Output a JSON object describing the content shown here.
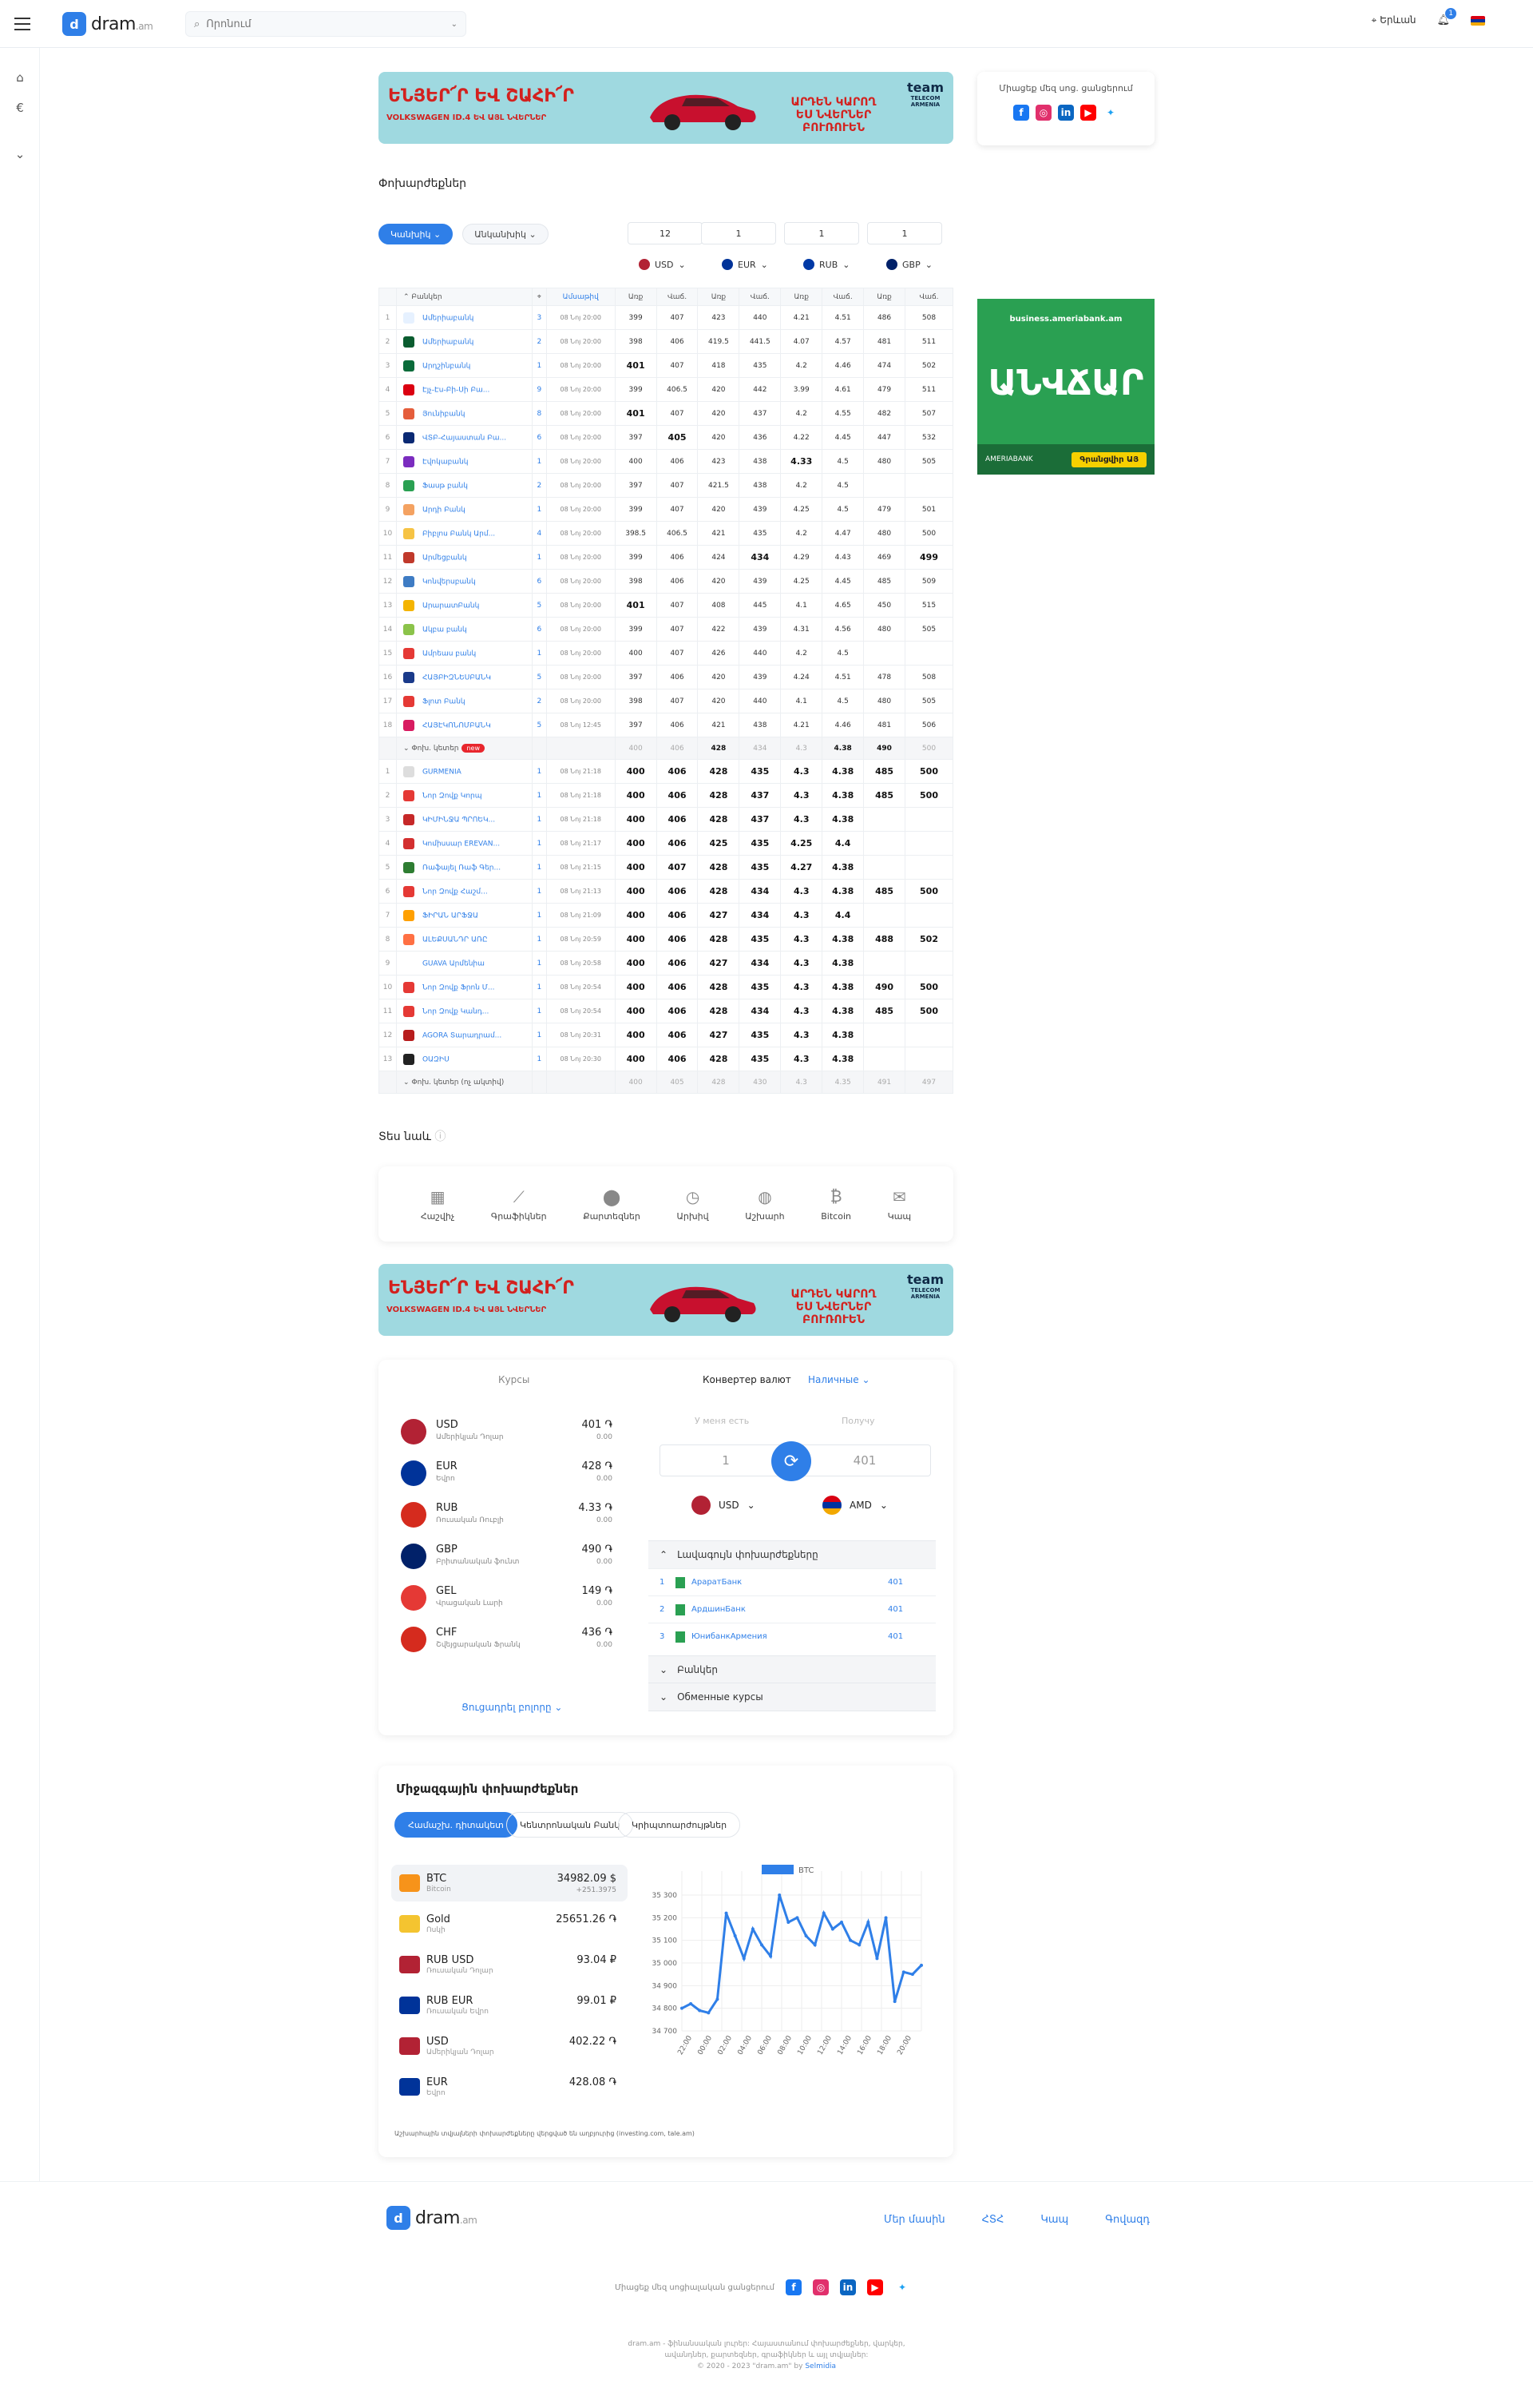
{
  "header": {
    "logo_text": "dram",
    "logo_domain": ".am",
    "search_placeholder": "Որոնում",
    "city": "Երևան",
    "notif_count": "1"
  },
  "banner": {
    "line1": "ԵՆՅԵՐ՜Ր ԵՎ ՇԱՀԻ՜Ր",
    "line2": "VOLKSWAGEN ID.4 ԵՎ ԱՅԼ ՆՎԵՐՆԵՐ",
    "right": "ԱՐԴԵՆ ԿԱՐՈՂ ԵՍ ՆՎԵՐՆԵՐ ԲՈՒՌՈՒԵՆ",
    "brand": "team",
    "brand_sub": "TELECOM ARMENIA"
  },
  "social": {
    "title": "Միացեք մեզ սոց. ցանցերում"
  },
  "section_title": "Փոխարժեքներ",
  "tabs": [
    "Կանխիկ",
    "Անկանխիկ"
  ],
  "amounts": [
    "12",
    "1",
    "1",
    "1"
  ],
  "currencies": [
    {
      "code": "USD",
      "color": "#b22234"
    },
    {
      "code": "EUR",
      "color": "#003399"
    },
    {
      "code": "RUB",
      "color": "#0039a6"
    },
    {
      "code": "GBP",
      "color": "#012169"
    }
  ],
  "ad_right": {
    "url": "business.ameriabank.am",
    "big": "ԱՆՎՃԱՐ",
    "bank": "AMERIABANK",
    "button": "Գրանցվիր ԱՅ"
  },
  "table": {
    "headers": {
      "banks": "Բանկեր",
      "date": "Ամսաթիվ",
      "buy": "Առք",
      "sell": "Վաճ."
    },
    "banks": [
      {
        "n": "1",
        "name": "Ամերիաբանկ",
        "br": "3",
        "t": "08 Նոյ 20:00",
        "v": [
          "399",
          "407",
          "423",
          "440",
          "4.21",
          "4.51",
          "486",
          "508"
        ],
        "c": "#e6f1ff"
      },
      {
        "n": "2",
        "name": "Ամերիաբանկ",
        "br": "2",
        "t": "08 Նոյ 20:00",
        "v": [
          "398",
          "406",
          "419.5",
          "441.5",
          "4.07",
          "4.57",
          "481",
          "511"
        ],
        "c": "#0a5c2f"
      },
      {
        "n": "3",
        "name": "Արդշինբանկ",
        "br": "1",
        "t": "08 Նոյ 20:00",
        "v": [
          "401",
          "407",
          "418",
          "435",
          "4.2",
          "4.46",
          "474",
          "502"
        ],
        "c": "#0a6b3a"
      },
      {
        "n": "4",
        "name": "Էյչ-Էս-Բի-Սի Բա...",
        "br": "9",
        "t": "08 Նոյ 20:00",
        "v": [
          "399",
          "406.5",
          "420",
          "442",
          "3.99",
          "4.61",
          "479",
          "511"
        ],
        "c": "#db0011"
      },
      {
        "n": "5",
        "name": "Յունիբանկ",
        "br": "8",
        "t": "08 Նոյ 20:00",
        "v": [
          "401",
          "407",
          "420",
          "437",
          "4.2",
          "4.55",
          "482",
          "507"
        ],
        "c": "#e55d3b"
      },
      {
        "n": "6",
        "name": "ՎՏԲ-Հայաստան Բա...",
        "br": "6",
        "t": "08 Նոյ 20:00",
        "v": [
          "397",
          "405",
          "420",
          "436",
          "4.22",
          "4.45",
          "447",
          "532"
        ],
        "c": "#0a2973"
      },
      {
        "n": "7",
        "name": "Էվոկաբանկ",
        "br": "1",
        "t": "08 Նոյ 20:00",
        "v": [
          "400",
          "406",
          "423",
          "438",
          "4.33",
          "4.5",
          "480",
          "505"
        ],
        "c": "#7b2cbf"
      },
      {
        "n": "8",
        "name": "Ֆասթ բանկ",
        "br": "2",
        "t": "08 Նոյ 20:00",
        "v": [
          "397",
          "407",
          "421.5",
          "438",
          "4.2",
          "4.5",
          "",
          ""
        ],
        "c": "#2aa052"
      },
      {
        "n": "9",
        "name": "Արդի Բանկ",
        "br": "1",
        "t": "08 Նոյ 20:00",
        "v": [
          "399",
          "407",
          "420",
          "439",
          "4.25",
          "4.5",
          "479",
          "501"
        ],
        "c": "#f4a261"
      },
      {
        "n": "10",
        "name": "Բիբլոս Բանկ Արմ...",
        "br": "4",
        "t": "08 Նոյ 20:00",
        "v": [
          "398.5",
          "406.5",
          "421",
          "435",
          "4.2",
          "4.47",
          "480",
          "500"
        ],
        "c": "#f6c344"
      },
      {
        "n": "11",
        "name": "Արմեցբանկ",
        "br": "1",
        "t": "08 Նոյ 20:00",
        "v": [
          "399",
          "406",
          "424",
          "434",
          "4.29",
          "4.43",
          "469",
          "499"
        ],
        "c": "#c0392b"
      },
      {
        "n": "12",
        "name": "Կոնվերսբանկ",
        "br": "6",
        "t": "08 Նոյ 20:00",
        "v": [
          "398",
          "406",
          "420",
          "439",
          "4.25",
          "4.45",
          "485",
          "509"
        ],
        "c": "#3e7cc4"
      },
      {
        "n": "13",
        "name": "ԱրարատԲանկ",
        "br": "5",
        "t": "08 Նոյ 20:00",
        "v": [
          "401",
          "407",
          "408",
          "445",
          "4.1",
          "4.65",
          "450",
          "515"
        ],
        "c": "#f4b400"
      },
      {
        "n": "14",
        "name": "Ակբա բանկ",
        "br": "6",
        "t": "08 Նոյ 20:00",
        "v": [
          "399",
          "407",
          "422",
          "439",
          "4.31",
          "4.56",
          "480",
          "505"
        ],
        "c": "#8bc34a"
      },
      {
        "n": "15",
        "name": "Ամրեաս բանկ",
        "br": "1",
        "t": "08 Նոյ 20:00",
        "v": [
          "400",
          "407",
          "426",
          "440",
          "4.2",
          "4.5",
          "",
          ""
        ],
        "c": "#e53935"
      },
      {
        "n": "16",
        "name": "ՀԱՅԲԻԶՆԵՍԲԱՆԿ",
        "br": "5",
        "t": "08 Նոյ 20:00",
        "v": [
          "397",
          "406",
          "420",
          "439",
          "4.24",
          "4.51",
          "478",
          "508"
        ],
        "c": "#1a3a8a"
      },
      {
        "n": "17",
        "name": "Ֆլոտ Բանկ",
        "br": "2",
        "t": "08 Նոյ 20:00",
        "v": [
          "398",
          "407",
          "420",
          "440",
          "4.1",
          "4.5",
          "480",
          "505"
        ],
        "c": "#e53935"
      },
      {
        "n": "18",
        "name": "ՀԱՅԷԿՈՆՈՄԲԱՆԿ",
        "br": "5",
        "t": "08 Նոյ 12:45",
        "v": [
          "397",
          "406",
          "421",
          "438",
          "4.21",
          "4.46",
          "481",
          "506"
        ],
        "c": "#d81b60"
      }
    ],
    "exch_label": "Փոխ. կետեր",
    "exch_new": "new",
    "exch_summary": [
      "400",
      "406",
      "428",
      "434",
      "4.3",
      "4.38",
      "490",
      "500"
    ],
    "exchanges": [
      {
        "n": "1",
        "name": "GURMENIA",
        "br": "1",
        "t": "08 Նոյ 21:18",
        "v": [
          "400",
          "406",
          "428",
          "435",
          "4.3",
          "4.38",
          "485",
          "500"
        ],
        "c": "#ddd"
      },
      {
        "n": "2",
        "name": "Նոր Զովք Կորպ",
        "br": "1",
        "t": "08 Նոյ 21:18",
        "v": [
          "400",
          "406",
          "428",
          "437",
          "4.3",
          "4.38",
          "485",
          "500"
        ],
        "c": "#e53935"
      },
      {
        "n": "3",
        "name": "ԿԻՄԻՆՋԱ ՊՐՈԵԿ...",
        "br": "1",
        "t": "08 Նոյ 21:18",
        "v": [
          "400",
          "406",
          "428",
          "437",
          "4.3",
          "4.38",
          "",
          ""
        ],
        "c": "#c62828"
      },
      {
        "n": "4",
        "name": "Կոմիսսար EREVAN...",
        "br": "1",
        "t": "08 Նոյ 21:17",
        "v": [
          "400",
          "406",
          "425",
          "435",
          "4.25",
          "4.4",
          "",
          ""
        ],
        "c": "#d32f2f"
      },
      {
        "n": "5",
        "name": "Ռաֆայել Ռաֆ Գեր...",
        "br": "1",
        "t": "08 Նոյ 21:15",
        "v": [
          "400",
          "407",
          "428",
          "435",
          "4.27",
          "4.38",
          "",
          ""
        ],
        "c": "#2e7d32"
      },
      {
        "n": "6",
        "name": "Նոր Զովք Հաշմ...",
        "br": "1",
        "t": "08 Նոյ 21:13",
        "v": [
          "400",
          "406",
          "428",
          "434",
          "4.3",
          "4.38",
          "485",
          "500"
        ],
        "c": "#e53935"
      },
      {
        "n": "7",
        "name": "ՖԻՐԱՆ ԱՐՖՋԱ",
        "br": "1",
        "t": "08 Նոյ 21:09",
        "v": [
          "400",
          "406",
          "427",
          "434",
          "4.3",
          "4.4",
          "",
          ""
        ],
        "c": "#ffa000"
      },
      {
        "n": "8",
        "name": "ԱԼԵՔՍԱՆԴՐ ԱՌԸ",
        "br": "1",
        "t": "08 Նոյ 20:59",
        "v": [
          "400",
          "406",
          "428",
          "435",
          "4.3",
          "4.38",
          "488",
          "502"
        ],
        "c": "#ff7043"
      },
      {
        "n": "9",
        "name": "GUAVA Արմենիա",
        "br": "1",
        "t": "08 Նոյ 20:58",
        "v": [
          "400",
          "406",
          "427",
          "434",
          "4.3",
          "4.38",
          "",
          ""
        ],
        "c": "#fff"
      },
      {
        "n": "10",
        "name": "Նոր Զովք Ֆրոն Մ...",
        "br": "1",
        "t": "08 Նոյ 20:54",
        "v": [
          "400",
          "406",
          "428",
          "435",
          "4.3",
          "4.38",
          "490",
          "500"
        ],
        "c": "#e53935"
      },
      {
        "n": "11",
        "name": "Նոր Զովք Կանդ...",
        "br": "1",
        "t": "08 Նոյ 20:54",
        "v": [
          "400",
          "406",
          "428",
          "434",
          "4.3",
          "4.38",
          "485",
          "500"
        ],
        "c": "#e53935"
      },
      {
        "n": "12",
        "name": "AGORA Տարադրամ...",
        "br": "1",
        "t": "08 Նոյ 20:31",
        "v": [
          "400",
          "406",
          "427",
          "435",
          "4.3",
          "4.38",
          "",
          ""
        ],
        "c": "#b71c1c"
      },
      {
        "n": "13",
        "name": "ՕԱԶԻՍ",
        "br": "1",
        "t": "08 Նոյ 20:30",
        "v": [
          "400",
          "406",
          "428",
          "435",
          "4.3",
          "4.38",
          "",
          ""
        ],
        "c": "#222"
      }
    ],
    "exch2_label": "Փոխ. կետեր (ոչ ակտիվ)",
    "exch2_summary": [
      "400",
      "405",
      "428",
      "430",
      "4.3",
      "4.35",
      "491",
      "497"
    ]
  },
  "see_also": {
    "title": "Տես նաև",
    "items": [
      {
        "icon": "▦",
        "label": "Հաշվիչ"
      },
      {
        "icon": "⟋",
        "label": "Գրաֆիկներ"
      },
      {
        "icon": "⬤",
        "label": "Քարտեզներ"
      },
      {
        "icon": "◷",
        "label": "Արխիվ"
      },
      {
        "icon": "◍",
        "label": "Աշխարհ"
      },
      {
        "icon": "₿",
        "label": "Bitcoin"
      },
      {
        "icon": "✉",
        "label": "Կապ"
      }
    ]
  },
  "converter": {
    "rates_title": "Курсы",
    "conv_title": "Конвертер валют",
    "cash": "Наличные",
    "have": "У меня есть",
    "get": "Получу",
    "have_val": "1",
    "get_val": "401",
    "from": "USD",
    "to": "AMD",
    "rates": [
      {
        "code": "USD",
        "name": "Ամերիկյան Դոլար",
        "val": "401 ֏",
        "chg": "0.00",
        "c": "#b22234"
      },
      {
        "code": "EUR",
        "name": "Եվրո",
        "val": "428 ֏",
        "chg": "0.00",
        "c": "#003399"
      },
      {
        "code": "RUB",
        "name": "Ռուսական Ռուբլի",
        "val": "4.33 ֏",
        "chg": "0.00",
        "c": "#d52b1e"
      },
      {
        "code": "GBP",
        "name": "Բրիտանական ֆունտ",
        "val": "490 ֏",
        "chg": "0.00",
        "c": "#012169"
      },
      {
        "code": "GEL",
        "name": "Վրացական Լարի",
        "val": "149 ֏",
        "chg": "0.00",
        "c": "#e53935"
      },
      {
        "code": "CHF",
        "name": "Շվեյցարական Ֆրանկ",
        "val": "436 ֏",
        "chg": "0.00",
        "c": "#d52b1e"
      }
    ],
    "show_all": "Ցուցադրել բոլորը",
    "best_title": "Լավագույն փոխարժեքները",
    "best": [
      {
        "n": "1",
        "name": "АраратБанк",
        "v": "401"
      },
      {
        "n": "2",
        "name": "АрдшинБанк",
        "v": "401"
      },
      {
        "n": "3",
        "name": "ЮнибанкАрмения",
        "v": "401"
      }
    ],
    "banks_label": "Բանկեր",
    "exch_label": "Обменные курсы"
  },
  "intl": {
    "title": "Միջազգային փոխարժեքներ",
    "tabs": [
      "Համաշխ. դիտակետ",
      "Կենտրոնական Բանկ",
      "Կրիպտոարժույթներ"
    ],
    "assets": [
      {
        "code": "BTC",
        "name": "Bitcoin",
        "val": "34982.09 $",
        "chg": "+251.3975",
        "c": "#f7931a"
      },
      {
        "code": "Gold",
        "name": "Ոսկի",
        "val": "25651.26 ֏",
        "chg": "",
        "c": "#f4c430"
      },
      {
        "code": "RUB USD",
        "name": "Ռուսական Դոլար",
        "val": "93.04 ₽",
        "chg": "",
        "c": "#b22234"
      },
      {
        "code": "RUB EUR",
        "name": "Ռուսական Եվրո",
        "val": "99.01 ₽",
        "chg": "",
        "c": "#003399"
      },
      {
        "code": "USD",
        "name": "Ամերիկյան Դոլար",
        "val": "402.22 ֏",
        "chg": "",
        "c": "#b22234"
      },
      {
        "code": "EUR",
        "name": "Եվրո",
        "val": "428.08 ֏",
        "chg": "",
        "c": "#003399"
      }
    ],
    "note": "Աշխարհային տվյալների փոխարժեքները վերցված են աղբյուրից (investing.com, tale.am)"
  },
  "chart_data": {
    "type": "line",
    "series": [
      {
        "name": "BTC",
        "values": [
          34800,
          34820,
          34790,
          34780,
          34840,
          35220,
          35120,
          35020,
          35150,
          35080,
          35030,
          35300,
          35180,
          35200,
          35120,
          35080,
          35220,
          35150,
          35180,
          35100,
          35080,
          35180,
          35020,
          35200,
          34830,
          34960,
          34950,
          34990
        ]
      }
    ],
    "x_ticks": [
      "22:00",
      "00:00",
      "02:00",
      "04:00",
      "06:00",
      "08:00",
      "10:00",
      "12:00",
      "14:00",
      "16:00",
      "18:00",
      "20:00"
    ],
    "y_ticks": [
      "35 300",
      "35 200",
      "35 100",
      "35 000",
      "34 900",
      "34 800",
      "34 700"
    ],
    "ylim": [
      34700,
      35300
    ],
    "color": "#2f7fe8"
  },
  "footer": {
    "links": [
      "Մեր մասին",
      "ՀՏՀ",
      "Կապ",
      "Գովազդ"
    ],
    "social": "Միացեք մեզ սոցիալական ցանցերում",
    "copy1": "dram.am - ֆինանսական լուրեր: Հայաստանում փոխարժեքներ, վարկեր,",
    "copy2": "ավանդներ, քարտեզներ, գրաֆիկներ և այլ տվյալներ:",
    "copy3": "© 2020 - 2023 \"dram.am\" by",
    "copy_brand": "Selmidia"
  }
}
